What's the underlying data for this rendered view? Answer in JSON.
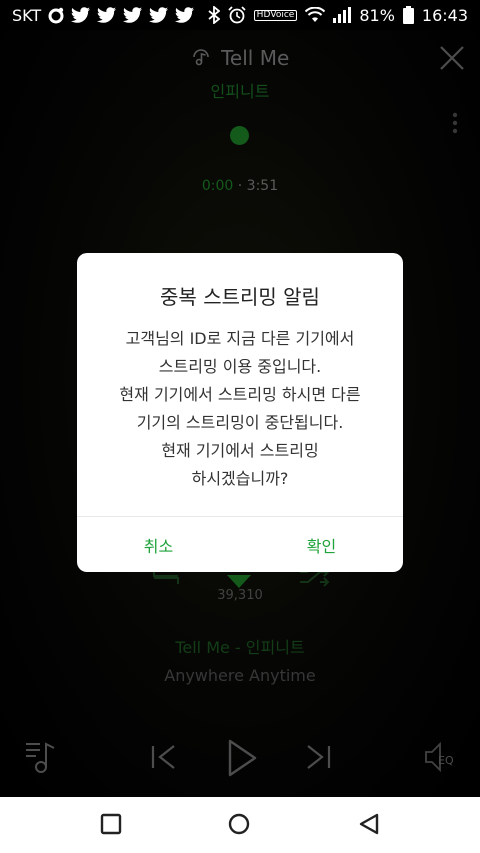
{
  "status_bar": {
    "carrier": "SKT",
    "battery": "81%",
    "time": "16:43",
    "hd_label": "HD",
    "voice_label": "Voice",
    "icons": [
      "circle-app-icon",
      "twitter-icon",
      "twitter-icon",
      "twitter-icon",
      "twitter-icon",
      "twitter-icon",
      "bluetooth-icon",
      "alarm-icon",
      "hd-voice-icon",
      "wifi-icon",
      "signal-icon",
      "battery-icon"
    ]
  },
  "player": {
    "title": "Tell Me",
    "artist": "인피니트",
    "current_time": "0:00",
    "separator": "·",
    "duration": "3:51",
    "like_count": "39,310",
    "song_line": "Tell Me - 인피니트",
    "album": "Anywhere Anytime",
    "eq_label": "EQ",
    "accent_color": "#1e8a2a"
  },
  "dialog": {
    "title": "중복 스트리밍 알림",
    "message_lines": [
      "고객님의 ID로 지금 다른 기기에서",
      "스트리밍 이용 중입니다.",
      "현재 기기에서 스트리밍 하시면 다른",
      "기기의 스트리밍이 중단됩니다.",
      "현재 기기에서 스트리밍",
      "하시겠습니까?"
    ],
    "cancel_label": "취소",
    "confirm_label": "확인",
    "button_color": "#1fa33a"
  }
}
